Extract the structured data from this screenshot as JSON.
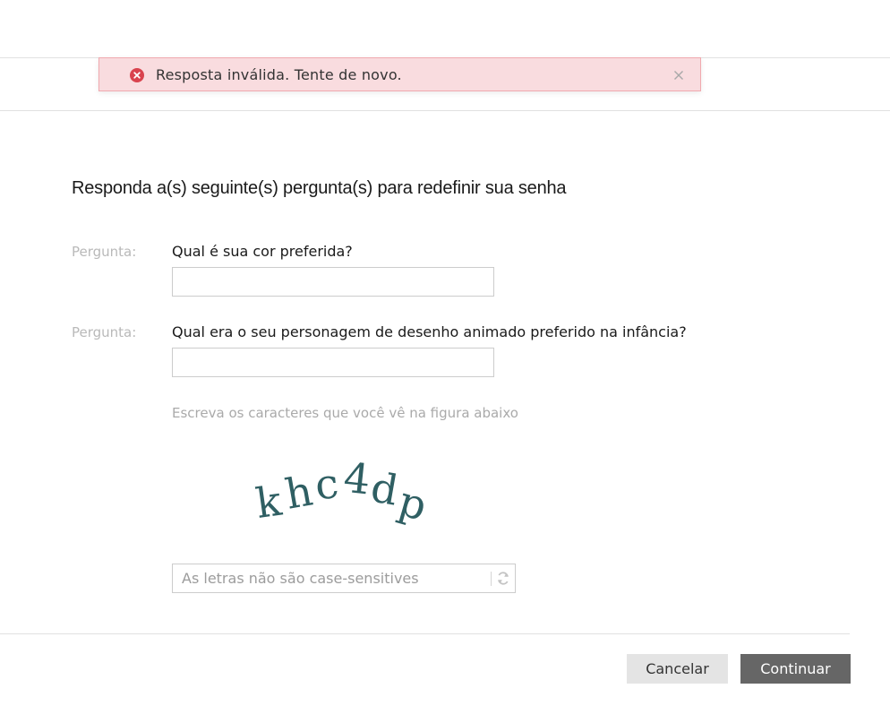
{
  "alert": {
    "message": "Resposta inválida. Tente de novo.",
    "icon": "error-circle-icon",
    "close_icon": "close-icon",
    "color": "#d9434e"
  },
  "page": {
    "title": "Responda a(s) seguinte(s) pergunta(s) para redefinir sua senha"
  },
  "questions": [
    {
      "label": "Pergunta:",
      "text": "Qual é sua cor preferida?",
      "value": ""
    },
    {
      "label": "Pergunta:",
      "text": "Qual era o seu personagem de desenho animado preferido na infância?",
      "value": ""
    }
  ],
  "captcha": {
    "hint": "Escreva os caracteres que você vê na figura abaixo",
    "image_text": "khc4dp",
    "placeholder": "As letras não são case-sensitives",
    "value": "",
    "refresh_icon": "refresh-icon"
  },
  "buttons": {
    "cancel": "Cancelar",
    "continue": "Continuar"
  }
}
